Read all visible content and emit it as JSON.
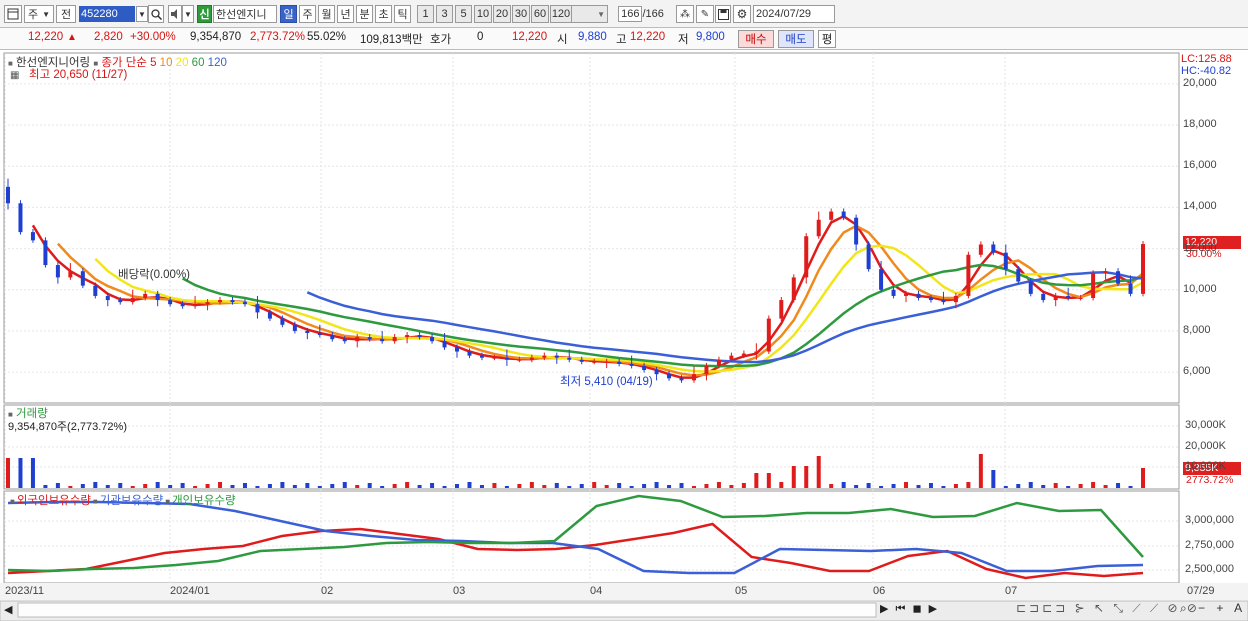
{
  "toolbar": {
    "type1": "주",
    "type2": "전",
    "code": "452280",
    "badge": "신",
    "stock_name": "한선엔지니",
    "periods": [
      "일",
      "주",
      "월",
      "년",
      "분",
      "초",
      "틱"
    ],
    "intervals": [
      "1",
      "3",
      "5",
      "10",
      "20",
      "30",
      "60",
      "120"
    ],
    "count": "166",
    "count_total": "/166",
    "date": "2024/07/29"
  },
  "info": {
    "price": "12,220",
    "change": "2,820",
    "change_pct": "+30.00%",
    "volume": "9,354,870",
    "volume_pct": "2,773.72%",
    "ratio": "55.02%",
    "amount": "109,813백만",
    "hoga_label": "호가",
    "hoga_value": "0",
    "hoga_price": "12,220",
    "open_label": "시",
    "open": "9,880",
    "high_label": "고",
    "high": "12,220",
    "low_label": "저",
    "low": "9,800",
    "buy": "매수",
    "sell": "매도",
    "avg": "평"
  },
  "price_panel": {
    "name": "한선엔지니어링",
    "ma_label": "종가 단순",
    "ma_periods": [
      "5",
      "10",
      "20",
      "60",
      "120"
    ],
    "ma_colors": [
      "#e01b1b",
      "#f08a1c",
      "#f2e619",
      "#2e9a3f",
      "#3a5fd6"
    ],
    "high_note": "최고 20,650 (11/27)",
    "low_note": "최저 5,410 (04/19)",
    "dividend_note": "배당락(0.00%)",
    "lc": "LC:125.88",
    "hc": "HC:-40.82",
    "y_ticks": [
      "20,000",
      "18,000",
      "16,000",
      "14,000",
      "12,000",
      "10,000",
      "8,000",
      "6,000"
    ],
    "last_price_tag": "12,220",
    "last_pct_tag": "30.00%"
  },
  "volume_panel": {
    "title": "거래량",
    "value_note": "9,354,870주(2,773.72%)",
    "y_ticks": [
      "30,000K",
      "20,000K",
      "10,000K"
    ],
    "last_tag": "9,355K",
    "last_pct": "2773.72%"
  },
  "holdings_panel": {
    "series": [
      "외국인보유수량",
      "기관보유수량",
      "개인보유수량"
    ],
    "colors": [
      "#e01b1b",
      "#3a5fd6",
      "#2e9a3f"
    ],
    "y_ticks": [
      "3,000,000",
      "2,750,000",
      "2,500,000"
    ]
  },
  "x_axis": [
    "2023/11",
    "2024/01",
    "02",
    "03",
    "04",
    "05",
    "06",
    "07",
    "07/29"
  ],
  "chart_data": {
    "type": "candlestick",
    "dates_range": [
      "2023/11",
      "2024/07/29"
    ],
    "ylim": [
      4500,
      21500
    ],
    "close": [
      14200,
      12800,
      12400,
      11200,
      10600,
      10900,
      10200,
      9700,
      9500,
      9400,
      9600,
      9800,
      9500,
      9300,
      9200,
      9300,
      9400,
      9500,
      9400,
      9300,
      8900,
      8600,
      8300,
      8000,
      7900,
      7800,
      7600,
      7500,
      7700,
      7600,
      7500,
      7700,
      7800,
      7700,
      7500,
      7200,
      7000,
      6800,
      6700,
      6700,
      6600,
      6600,
      6700,
      6800,
      6700,
      6600,
      6500,
      6500,
      6500,
      6400,
      6300,
      6100,
      5900,
      5700,
      5600,
      5900,
      6300,
      6600,
      6800,
      6900,
      7000,
      8600,
      9500,
      10600,
      12600,
      13400,
      13800,
      13500,
      12200,
      11000,
      10000,
      9700,
      9800,
      9600,
      9500,
      9400,
      9700,
      11700,
      12200,
      11800,
      11000,
      10400,
      9800,
      9500,
      9700,
      9600,
      9600,
      10800,
      10900,
      10300,
      9800,
      12220
    ],
    "holdings_foreign": [
      2480000,
      2500000,
      2520000,
      2600000,
      2680000,
      2720000,
      2750000,
      2850000,
      2900000,
      2920000,
      2870000,
      2820000,
      2720000,
      2710000,
      2720000,
      2760000,
      2820000,
      2880000,
      2970000,
      2640000,
      2580000,
      2500000,
      2500000,
      2650000,
      2700000,
      2520000,
      2430000,
      2480000,
      2450000,
      2480000
    ],
    "holdings_institution": [
      3180000,
      3190000,
      3190000,
      3180000,
      3170000,
      3100000,
      3000000,
      2900000,
      2850000,
      2810000,
      2800000,
      2780000,
      2780000,
      2720000,
      2500000,
      2480000,
      2480000,
      2720000,
      2710000,
      2700000,
      2720000,
      2680000,
      2500000,
      2500000,
      2550000,
      2560000
    ],
    "holdings_individual": [
      2510000,
      2500000,
      2520000,
      2530000,
      2560000,
      2600000,
      2700000,
      2720000,
      2740000,
      2780000,
      2790000,
      2780000,
      2780000,
      2800000,
      3150000,
      3250000,
      3200000,
      3040000,
      3050000,
      3080000,
      3080000,
      3120000,
      3040000,
      3050000,
      3180000,
      3100000,
      3110000,
      2640000
    ]
  }
}
